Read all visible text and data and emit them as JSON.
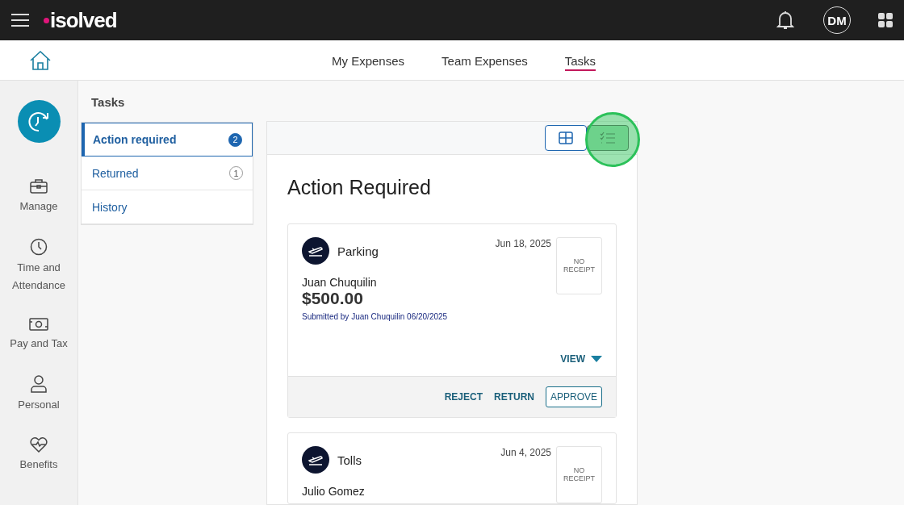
{
  "header": {
    "logo": "isolved",
    "avatar": "DM"
  },
  "nav": {
    "tabs": [
      {
        "label": "My Expenses",
        "selected": false
      },
      {
        "label": "Team Expenses",
        "selected": false
      },
      {
        "label": "Tasks",
        "selected": true
      }
    ]
  },
  "rail": {
    "items": [
      {
        "label": "Manage",
        "kind": "briefcase"
      },
      {
        "label": "Time and Attendance",
        "kind": "clock"
      },
      {
        "label": "Pay and Tax",
        "kind": "money"
      },
      {
        "label": "Personal",
        "kind": "person"
      },
      {
        "label": "Benefits",
        "kind": "heart"
      }
    ]
  },
  "tasks": {
    "title": "Tasks",
    "items": [
      {
        "label": "Action required",
        "count": "2",
        "selected": true
      },
      {
        "label": "Returned",
        "count": "1",
        "selected": false
      },
      {
        "label": "History",
        "selected": false
      }
    ]
  },
  "view_toggle": [
    {
      "kind": "grid",
      "selected": false,
      "highlighted": false
    },
    {
      "kind": "list",
      "selected": true,
      "highlighted": true
    }
  ],
  "main": {
    "title": "Action Required",
    "expenses": [
      {
        "category": "Parking",
        "date": "Jun 18, 2025",
        "receipt": "NO RECEIPT",
        "employee": "Juan Chuquilin",
        "amount": "$500.00",
        "submitted": "Submitted by Juan Chuquilin 06/20/2025",
        "view": "VIEW",
        "actions": [
          "REJECT",
          "RETURN",
          "APPROVE"
        ]
      },
      {
        "category": "Tolls",
        "date": "Jun 4, 2025",
        "receipt": "NO RECEIPT",
        "employee": "Julio Gomez"
      }
    ]
  }
}
